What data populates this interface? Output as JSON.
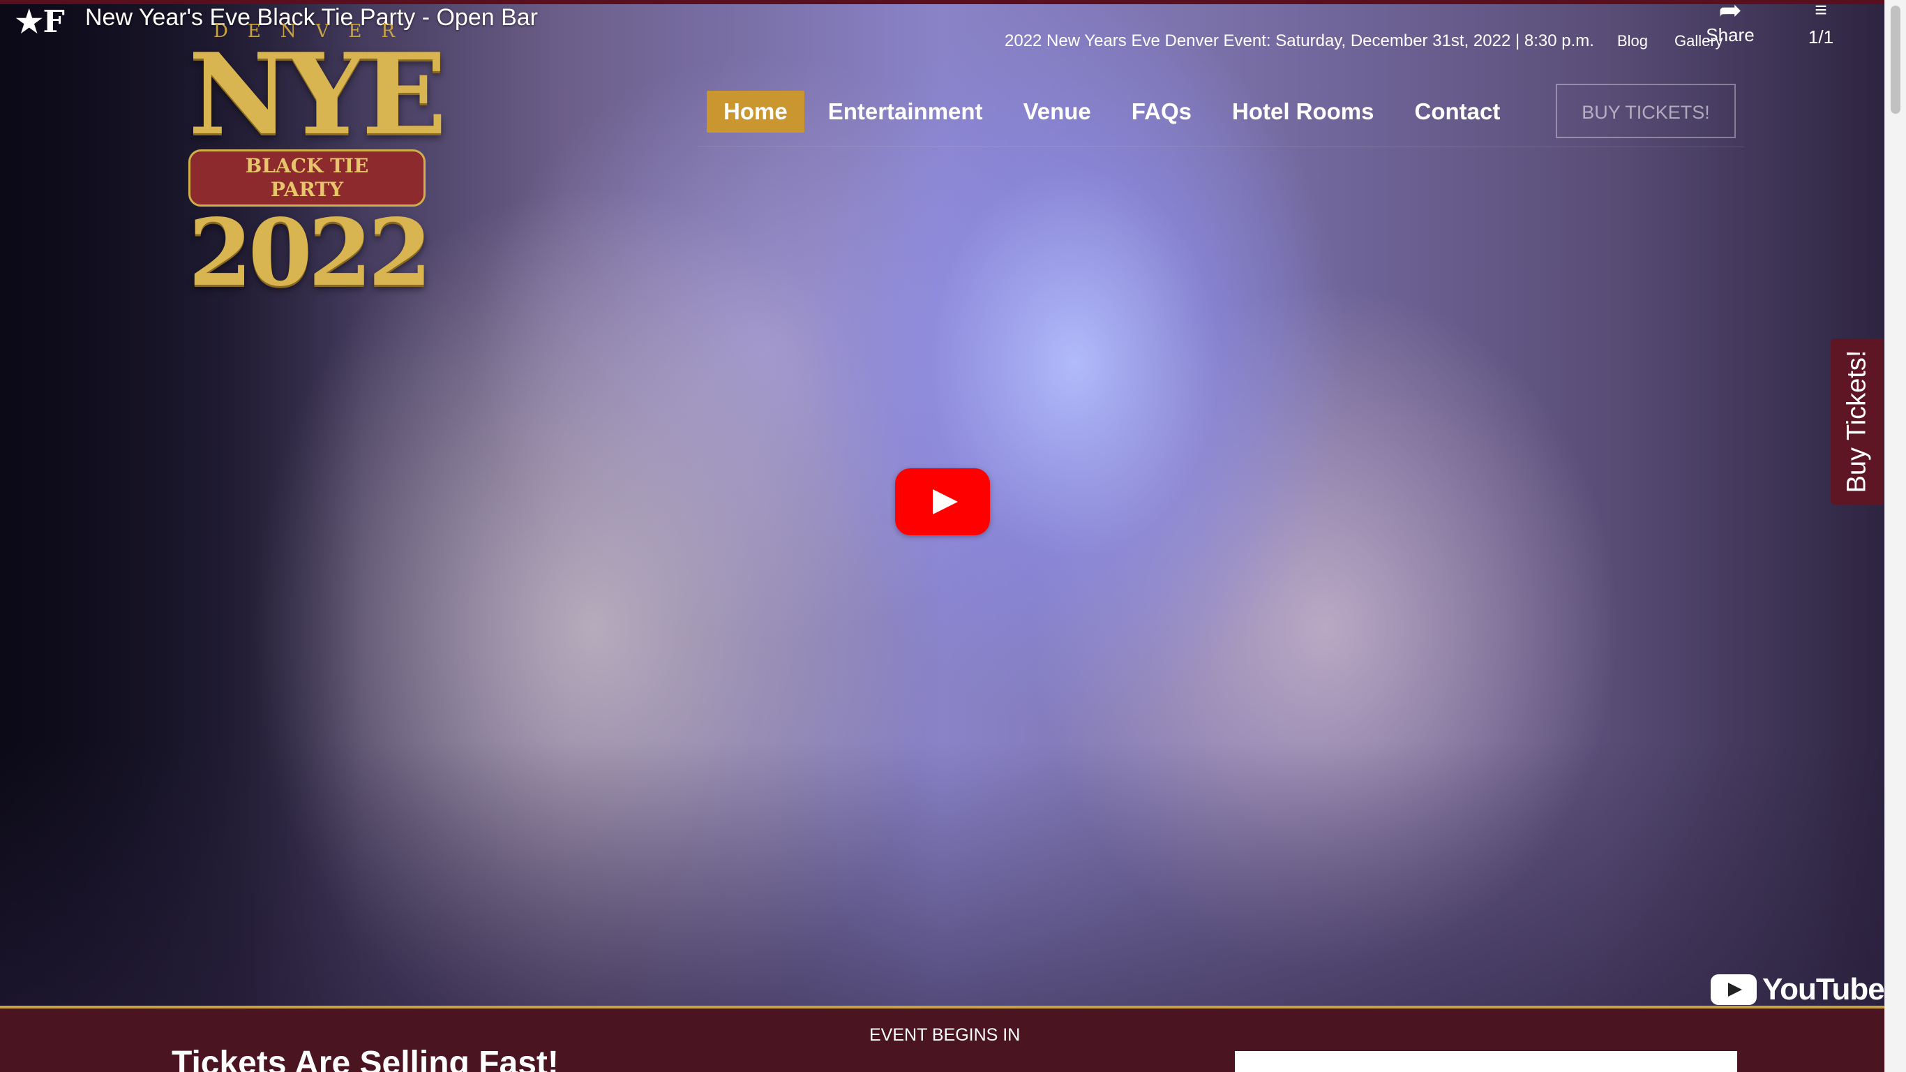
{
  "video": {
    "channel_logo": "★F",
    "title": "New Year's Eve Black Tie Party - Open Bar",
    "share_label": "Share",
    "playlist_count": "1/1",
    "youtube_label": "YouTube"
  },
  "logo": {
    "city": "DENVER",
    "name": "NYE",
    "ribbon": "BLACK TIE PARTY",
    "year": "2022"
  },
  "topbar": {
    "event_line": "2022 New Years Eve Denver Event: Saturday, December 31st, 2022 | 8:30 p.m.",
    "links": [
      "Blog",
      "Gallery"
    ]
  },
  "nav": {
    "items": [
      "Home",
      "Entertainment",
      "Venue",
      "FAQs",
      "Hotel Rooms",
      "Contact"
    ],
    "active": "Home",
    "buy_button": "BUY TICKETS!"
  },
  "side_tab": {
    "label": "Buy Tickets!"
  },
  "bottom": {
    "heading": "Tickets Are Selling Fast!",
    "countdown_label": "EVENT BEGINS IN"
  },
  "colors": {
    "brand_maroon": "#4a1420",
    "gold_accent": "#c9962f",
    "youtube_red": "#ff0000"
  }
}
